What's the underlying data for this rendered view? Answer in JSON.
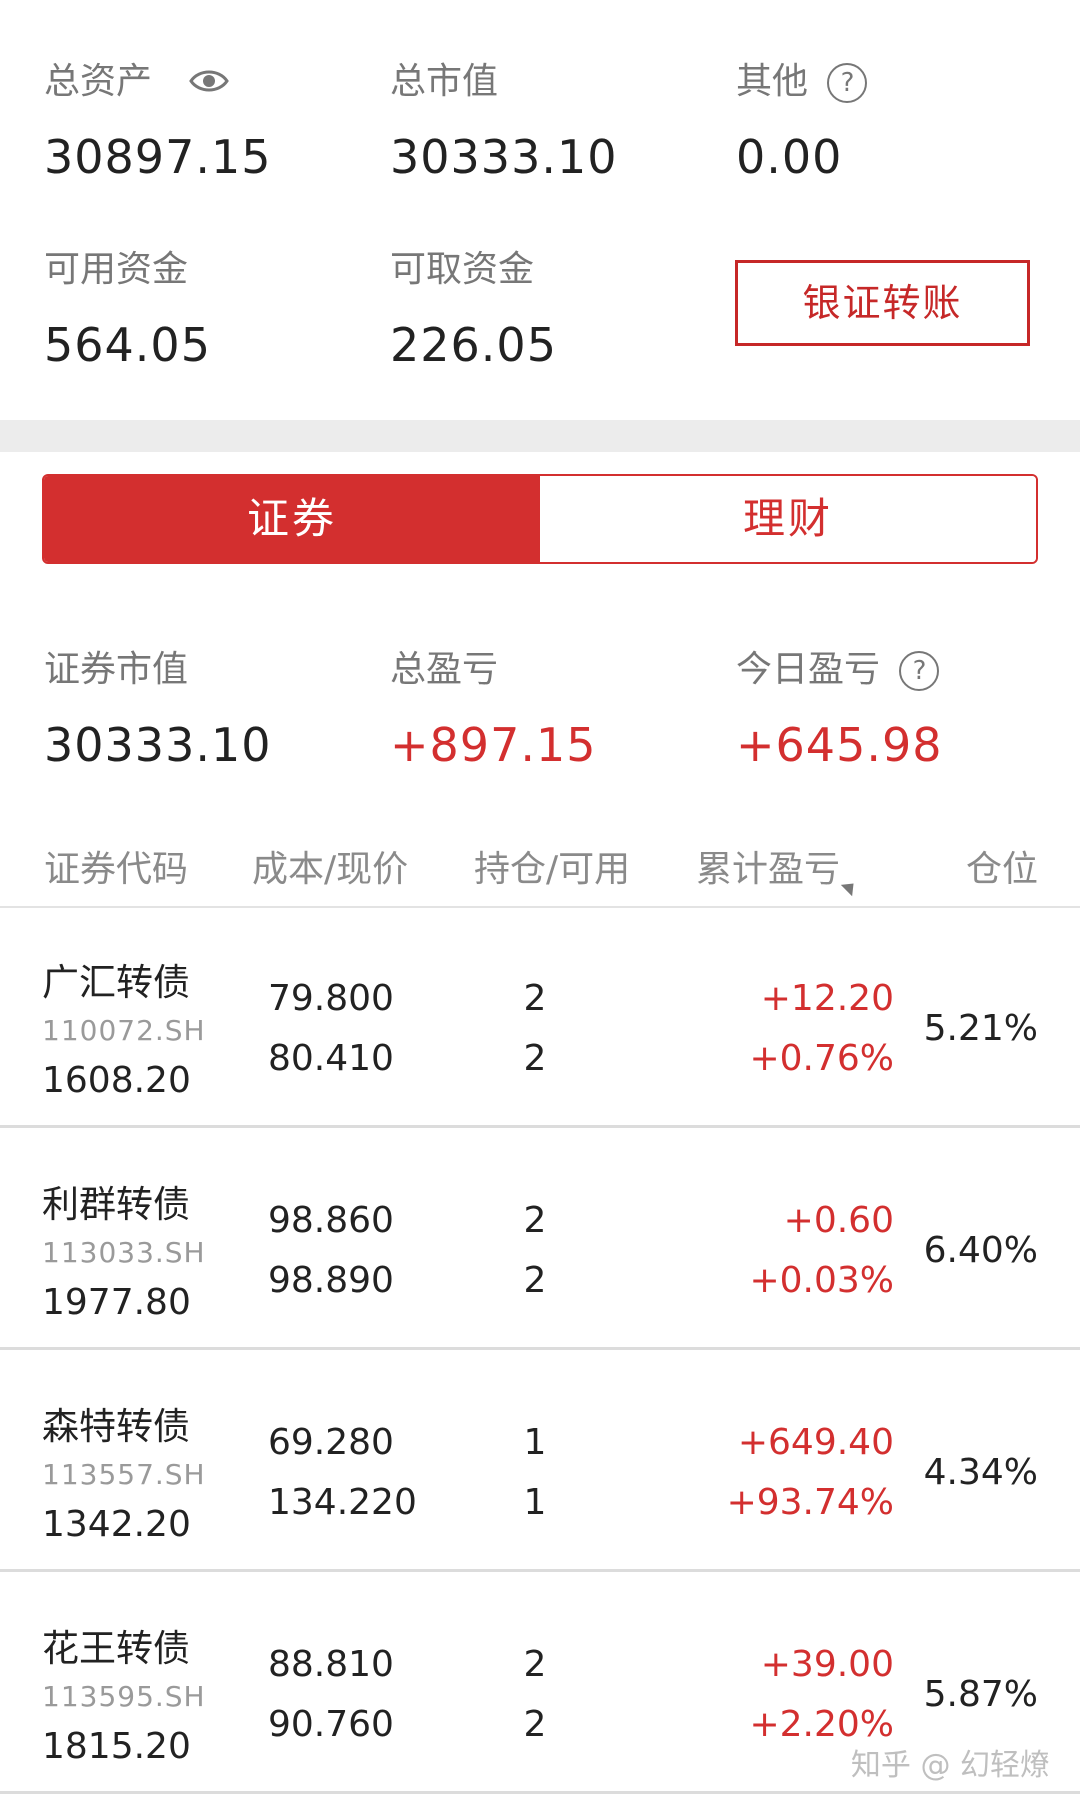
{
  "summary": {
    "total_assets_label": "总资产",
    "total_assets_value": "30897.15",
    "market_value_label": "总市值",
    "market_value_value": "30333.10",
    "other_label": "其他",
    "other_value": "0.00",
    "available_funds_label": "可用资金",
    "available_funds_value": "564.05",
    "withdrawable_funds_label": "可取资金",
    "withdrawable_funds_value": "226.05",
    "transfer_button_label": "银证转账"
  },
  "tabs": [
    {
      "label": "证券",
      "active": true
    },
    {
      "label": "理财",
      "active": false
    }
  ],
  "securities_summary": {
    "sec_market_value_label": "证券市值",
    "sec_market_value_value": "30333.10",
    "total_pl_label": "总盈亏",
    "total_pl_value": "+897.15",
    "today_pl_label": "今日盈亏",
    "today_pl_value": "+645.98"
  },
  "table": {
    "headers": [
      "证券代码",
      "成本/现价",
      "持仓/可用",
      "累计盈亏",
      "仓位"
    ],
    "rows": [
      {
        "name": "广汇转债",
        "code": "110072.SH",
        "market_value": "1608.20",
        "cost": "79.800",
        "price": "80.410",
        "holding": "2",
        "available": "2",
        "pl": "+12.20",
        "pl_pct": "+0.76%",
        "position": "5.21%"
      },
      {
        "name": "利群转债",
        "code": "113033.SH",
        "market_value": "1977.80",
        "cost": "98.860",
        "price": "98.890",
        "holding": "2",
        "available": "2",
        "pl": "+0.60",
        "pl_pct": "+0.03%",
        "position": "6.40%"
      },
      {
        "name": "森特转债",
        "code": "113557.SH",
        "market_value": "1342.20",
        "cost": "69.280",
        "price": "134.220",
        "holding": "1",
        "available": "1",
        "pl": "+649.40",
        "pl_pct": "+93.74%",
        "position": "4.34%"
      },
      {
        "name": "花王转债",
        "code": "113595.SH",
        "market_value": "1815.20",
        "cost": "88.810",
        "price": "90.760",
        "holding": "2",
        "available": "2",
        "pl": "+39.00",
        "pl_pct": "+2.20%",
        "position": "5.87%"
      }
    ]
  },
  "icons": {
    "eye": "eye-icon",
    "help": "question-circle-icon",
    "help_glyph": "?",
    "sort": "sort-triangle-icon"
  },
  "colors": {
    "accent_red": "#d32f2f",
    "band_gray": "#ececec"
  },
  "watermark": "知乎 @ 幻轻燎"
}
